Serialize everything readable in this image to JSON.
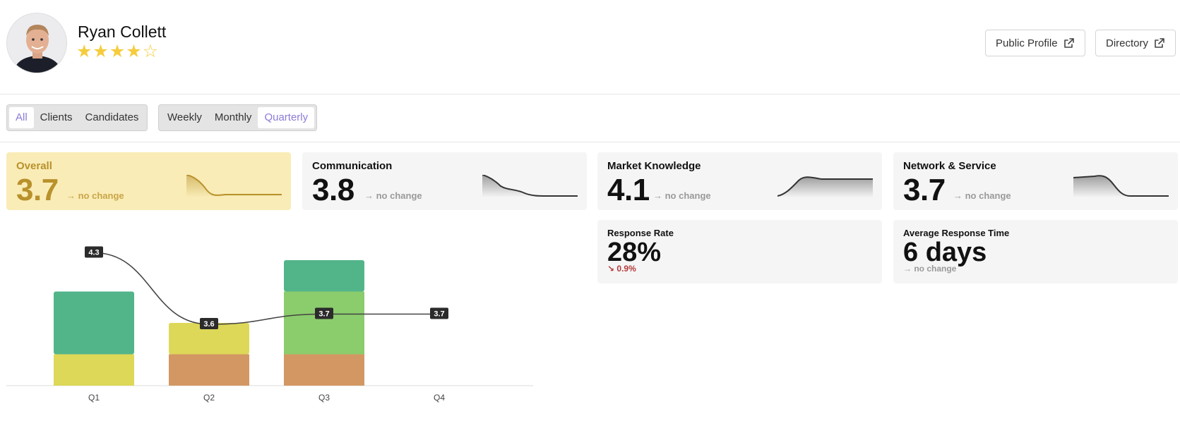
{
  "profile": {
    "name": "Ryan Collett",
    "rating": 4,
    "rating_max": 5,
    "stars_full_glyph": "★",
    "stars_empty_glyph": "☆"
  },
  "header_buttons": {
    "public_profile": "Public Profile",
    "directory": "Directory"
  },
  "audience_filter": {
    "options": [
      "All",
      "Clients",
      "Candidates"
    ],
    "selected": "All"
  },
  "period_filter": {
    "options": [
      "Weekly",
      "Monthly",
      "Quarterly"
    ],
    "selected": "Quarterly"
  },
  "kpis": [
    {
      "title": "Overall",
      "value": "3.7",
      "change": "→ no change",
      "highlight": true,
      "spark_color": "#b9912c"
    },
    {
      "title": "Communication",
      "value": "3.8",
      "change": "→ no change",
      "highlight": false,
      "spark_color": "#333333"
    },
    {
      "title": "Market Knowledge",
      "value": "4.1",
      "change": "→ no change",
      "highlight": false,
      "spark_color": "#333333"
    },
    {
      "title": "Network & Service",
      "value": "3.7",
      "change": "→ no change",
      "highlight": false,
      "spark_color": "#333333"
    }
  ],
  "response_rate": {
    "title": "Response Rate",
    "value": "28%",
    "change": "↘ 0.9%",
    "direction": "down"
  },
  "avg_response_time": {
    "title": "Average Response Time",
    "value": "6 days",
    "change": "→ no change"
  },
  "chart_data": {
    "type": "bar",
    "categories": [
      "Q1",
      "Q2",
      "Q3",
      "Q4"
    ],
    "stacked_segments": [
      {
        "color": "#ddd857",
        "values": [
          1,
          0,
          0,
          0
        ]
      },
      {
        "color": "#d39763",
        "values": [
          0,
          1,
          1,
          0
        ]
      },
      {
        "color": "#ddd857",
        "values": [
          0,
          1,
          0,
          0
        ]
      },
      {
        "color": "#8bcc6c",
        "values": [
          0,
          0,
          2,
          0
        ]
      },
      {
        "color": "#52b58a",
        "values": [
          2,
          0,
          1,
          0
        ]
      }
    ],
    "line": {
      "values": [
        4.3,
        3.6,
        3.7,
        3.7
      ],
      "labels": [
        "4.3",
        "3.6",
        "3.7",
        "3.7"
      ],
      "color": "#444444"
    }
  }
}
